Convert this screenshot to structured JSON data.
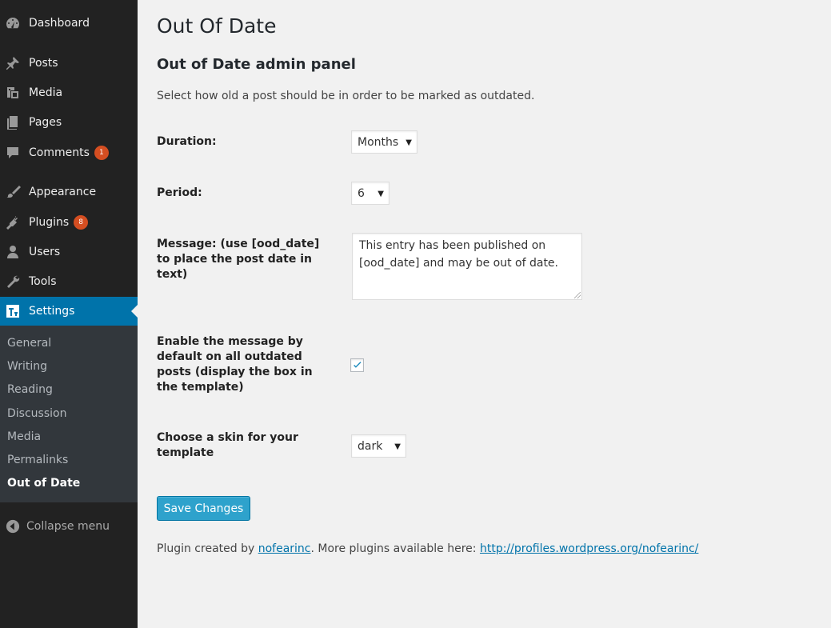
{
  "sidebar": {
    "items": [
      {
        "label": "Dashboard",
        "icon": "dashboard-icon"
      },
      {
        "label": "Posts",
        "icon": "pushpin-icon"
      },
      {
        "label": "Media",
        "icon": "media-icon"
      },
      {
        "label": "Pages",
        "icon": "pages-icon"
      },
      {
        "label": "Comments",
        "icon": "comment-icon",
        "badge": "1"
      },
      {
        "label": "Appearance",
        "icon": "paintbrush-icon"
      },
      {
        "label": "Plugins",
        "icon": "plug-icon",
        "badge": "8"
      },
      {
        "label": "Users",
        "icon": "user-icon"
      },
      {
        "label": "Tools",
        "icon": "wrench-icon"
      },
      {
        "label": "Settings",
        "icon": "settings-icon",
        "active": true
      }
    ],
    "submenu": [
      "General",
      "Writing",
      "Reading",
      "Discussion",
      "Media",
      "Permalinks",
      "Out of Date"
    ],
    "current_submenu": "Out of Date",
    "collapse_label": "Collapse menu"
  },
  "page": {
    "title": "Out Of Date",
    "panel_title": "Out of Date admin panel",
    "description": "Select how old a post should be in order to be marked as outdated."
  },
  "form": {
    "duration": {
      "label": "Duration:",
      "value": "Months"
    },
    "period": {
      "label": "Period:",
      "value": "6"
    },
    "message": {
      "label": "Message: (use [ood_date] to place the post date in text)",
      "value": "This entry has been published on [ood_date] and may be out of date."
    },
    "enable": {
      "label": "Enable the message by default on all outdated posts (display the box in the template)",
      "checked": true
    },
    "skin": {
      "label": "Choose a skin for your template",
      "value": "dark"
    },
    "save_label": "Save Changes"
  },
  "footer": {
    "prefix": "Plugin created by ",
    "author_link": "nofearinc",
    "middle": ". More plugins available here: ",
    "profile_link": "http://profiles.wordpress.org/nofearinc/"
  },
  "colors": {
    "sidebar_bg": "#222222",
    "active_bg": "#0073aa",
    "badge": "#d54e21",
    "button": "#2ea2cc",
    "checkmark": "#1e8cbe"
  }
}
